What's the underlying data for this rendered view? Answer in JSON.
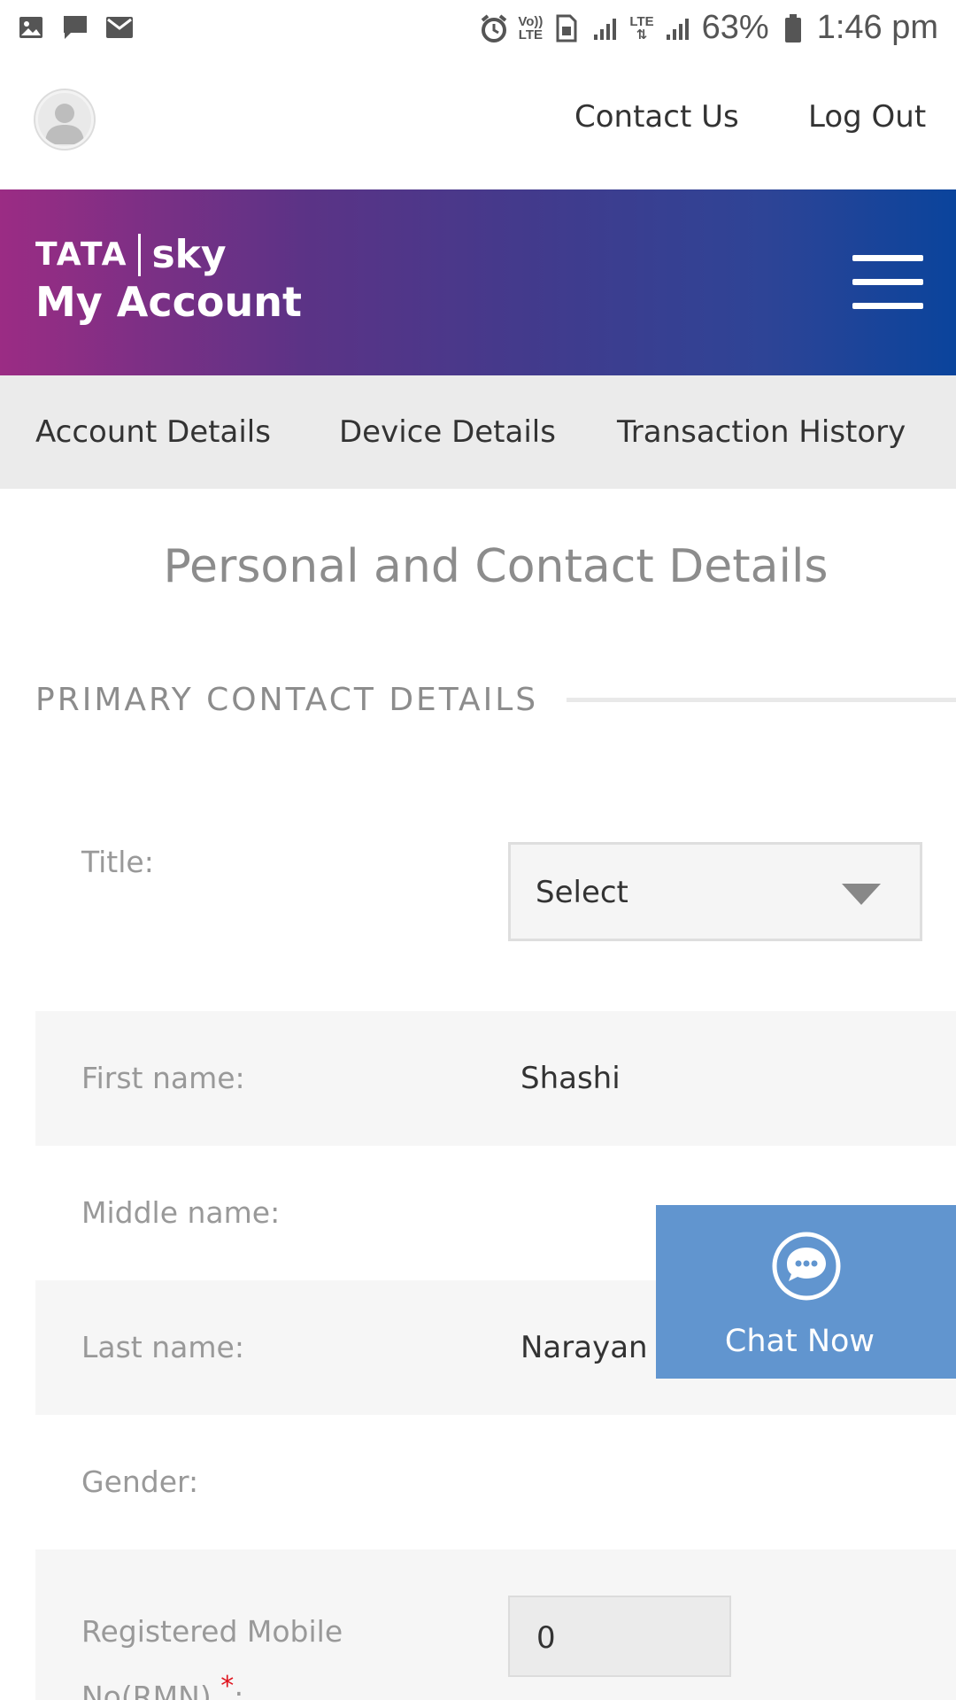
{
  "status_bar": {
    "battery": "63%",
    "time": "1:46 pm",
    "volte_top": "Vo))",
    "volte_bottom": "LTE",
    "lte_label": "LTE",
    "left_icons": [
      "image-icon",
      "chat-bubble-icon",
      "mail-icon"
    ],
    "right_icons": [
      "alarm-icon",
      "volte-icon",
      "sim-icon",
      "signal-icon",
      "lte-icon",
      "signal-icon",
      "battery-icon"
    ]
  },
  "header": {
    "contact_label": "Contact Us",
    "logout_label": "Log Out",
    "avatar_icon": "user-avatar-icon"
  },
  "brand": {
    "logo_left": "TATA",
    "logo_right": "sky",
    "title": "My Account",
    "menu_icon": "hamburger-menu-icon",
    "gradient_start": "#9b2c84",
    "gradient_end": "#0a449c"
  },
  "tabs": [
    {
      "label": "Account Details"
    },
    {
      "label": "Device Details"
    },
    {
      "label": "Transaction History"
    }
  ],
  "page": {
    "title": "Personal and Contact Details",
    "section_heading": "PRIMARY CONTACT DETAILS"
  },
  "form": {
    "title_label": "Title:",
    "title_select_value": "Select",
    "first_name_label": "First name:",
    "first_name_value": "Shashi",
    "middle_name_label": "Middle name:",
    "middle_name_value": "",
    "last_name_label": "Last name:",
    "last_name_value": "Narayan",
    "gender_label": "Gender:",
    "rmn_label_line1": "Registered Mobile",
    "rmn_label_line2": "No(RMN)",
    "rmn_required_mark": "*",
    "rmn_colon": ":",
    "rmn_value": "0"
  },
  "chat": {
    "label": "Chat Now",
    "icon": "chat-bubble-dots-icon",
    "color": "#6195cf"
  }
}
